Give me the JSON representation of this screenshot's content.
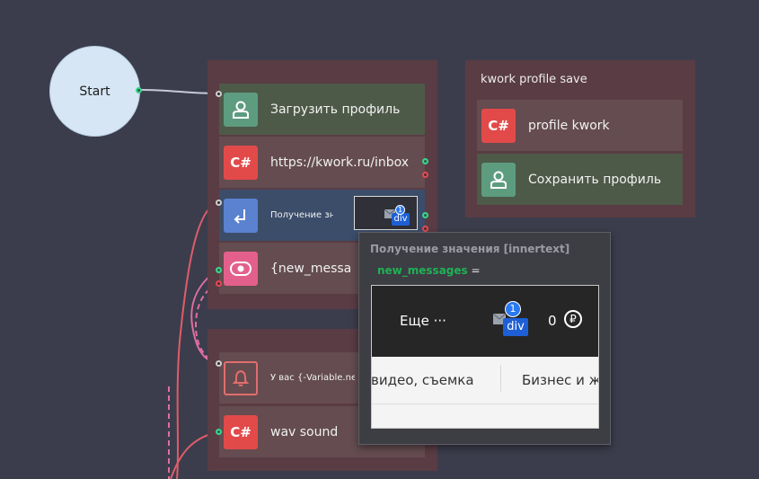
{
  "start": {
    "label": "Start"
  },
  "group1": {
    "blocks": [
      {
        "label": "Загрузить профиль",
        "icon": "user-icon",
        "color": "#5e9c80"
      },
      {
        "label": "https://kwork.ru/inbox",
        "icon_text": "C#",
        "color": "#e24a4a"
      },
      {
        "label": "Получение значения [innertext]",
        "icon": "arrow-return-icon",
        "color": "#5a82cf"
      },
      {
        "label": "{new_messag",
        "icon": "toggle-icon",
        "color": "#e3608c"
      }
    ],
    "chip": {
      "badge_num": "1",
      "badge_text": "div"
    }
  },
  "group2": {
    "blocks": [
      {
        "label": "У вас {-Variable.new_mess… новых сообщений",
        "icon": "bell-icon",
        "color": "#e26d6d"
      },
      {
        "label": "wav sound",
        "icon_text": "C#",
        "color": "#e24a4a"
      }
    ]
  },
  "group3": {
    "title": "kwork profile save",
    "blocks": [
      {
        "label": "profile kwork",
        "icon_text": "C#",
        "color": "#e24a4a"
      },
      {
        "label": "Сохранить профиль",
        "icon": "user-icon",
        "color": "#5e9c80"
      }
    ]
  },
  "tooltip": {
    "title": "Получение значения [innertext]",
    "var_name": "new_messages",
    "equals": "=",
    "preview": {
      "more": "Еще ···",
      "badge_num": "1",
      "badge_text": "div",
      "balance": "0",
      "currency": "₽",
      "cat1": "видео, съемка",
      "cat2": "Бизнес и ж"
    }
  },
  "colors": {
    "background": "#3b3d4c",
    "group": "#5a3c44",
    "port_green": "#3bd48b",
    "port_red": "#e64a55"
  }
}
